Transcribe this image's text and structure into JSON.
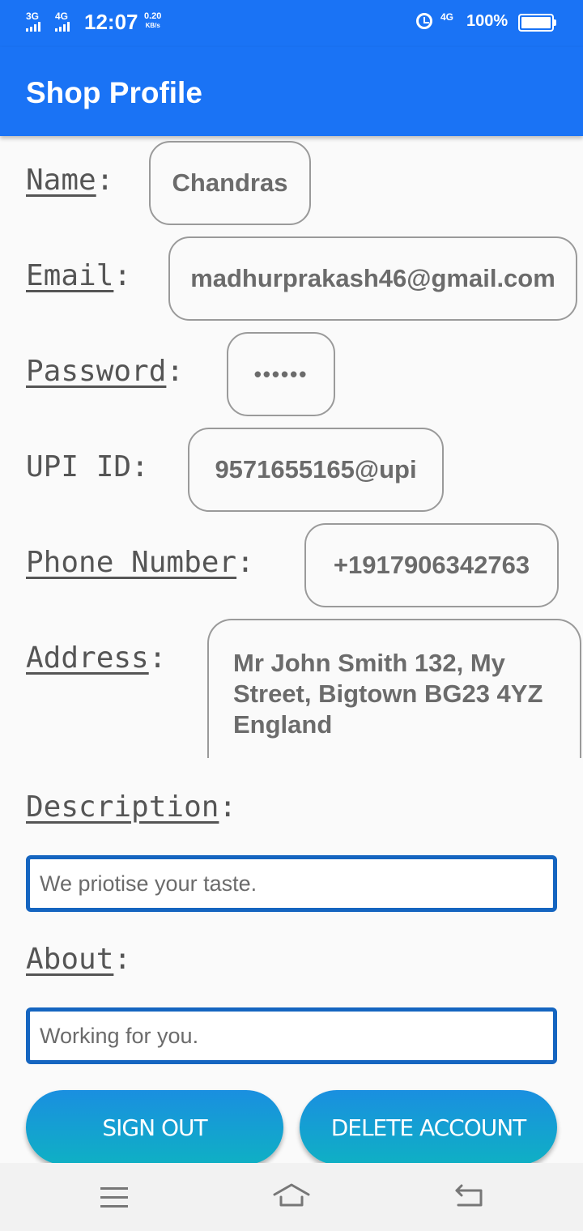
{
  "status_bar": {
    "sim1": "3G",
    "sim2": "4G",
    "time": "12:07",
    "speed_value": "0.20",
    "speed_unit": "KB/s",
    "net_badge": "4G",
    "battery": "100%"
  },
  "app_bar": {
    "title": "Shop Profile"
  },
  "fields": {
    "name": {
      "label": "Name",
      "value": "Chandras"
    },
    "email": {
      "label": "Email",
      "value": "madhurprakash46@gmail.com"
    },
    "password": {
      "label": "Password",
      "value": "••••••"
    },
    "upi": {
      "label": "UPI ID",
      "value": "9571655165@upi"
    },
    "phone": {
      "label": "Phone Number",
      "value": "+1917906342763"
    },
    "address": {
      "label": "Address",
      "value": "Mr John Smith 132, My Street, Bigtown BG23 4YZ England"
    }
  },
  "description": {
    "label": "Description",
    "value": "We priotise your taste."
  },
  "about": {
    "label": "About",
    "value": "Working for you."
  },
  "buttons": {
    "sign_out": "SIGN OUT",
    "delete_account": "DELETE ACCOUNT"
  },
  "colors": {
    "primary": "#1a73f5",
    "input_border": "#1565c0",
    "button_top": "#1a8fe0",
    "button_bottom": "#0fb0c4"
  },
  "icons": {
    "nav": [
      "menu-icon",
      "home-icon",
      "back-icon"
    ]
  }
}
